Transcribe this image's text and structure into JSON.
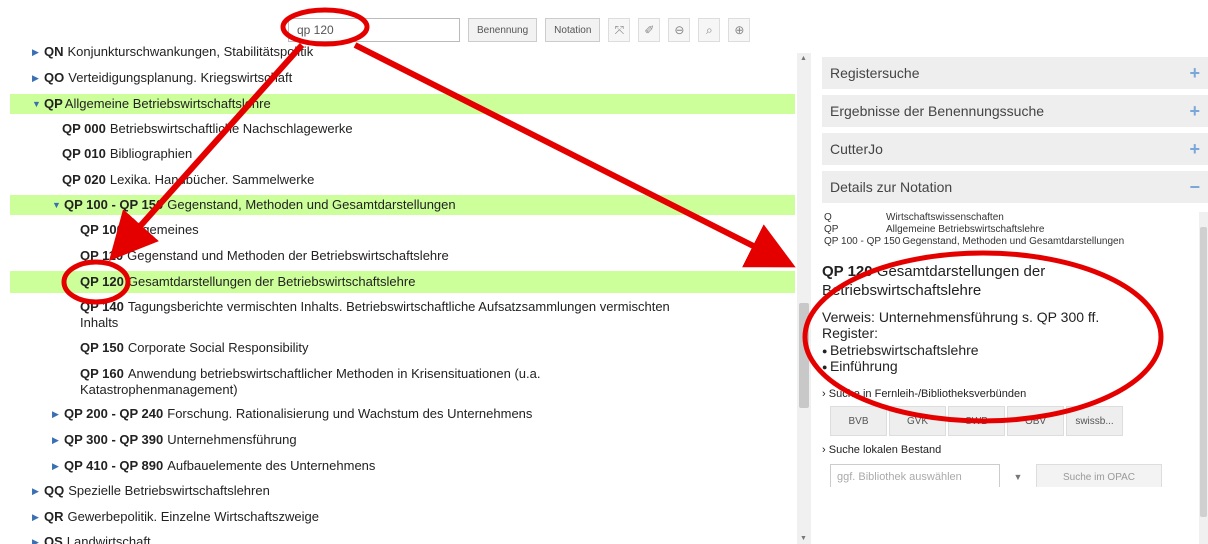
{
  "toolbar": {
    "search_value": "qp 120",
    "benennung": "Benennung",
    "notation": "Notation"
  },
  "tree": {
    "rows": [
      {
        "code": "QN",
        "text": "Konjunkturschwankungen, Stabilitätspolitik"
      },
      {
        "code": "QO",
        "text": "Verteidigungsplanung. Kriegswirtschaft"
      },
      {
        "code": "QP",
        "text": "Allgemeine Betriebswirtschaftslehre"
      },
      {
        "code": "QP 000",
        "text": "Betriebswirtschaftliche Nachschlagewerke"
      },
      {
        "code": "QP 010",
        "text": "Bibliographien"
      },
      {
        "code": "QP 020",
        "text": "Lexika. Handbücher. Sammelwerke"
      },
      {
        "code": "QP 100 - QP 150",
        "text": "Gegenstand, Methoden und Gesamtdarstellungen"
      },
      {
        "code": "QP 100",
        "text": "Allgemeines"
      },
      {
        "code": "QP 110",
        "text": "Gegenstand und Methoden der Betriebswirtschaftslehre"
      },
      {
        "code": "QP 120",
        "text": "Gesamtdarstellungen der Betriebswirtschaftslehre"
      },
      {
        "code": "QP 140",
        "text": "Tagungsberichte vermischten Inhalts. Betriebswirtschaftliche Aufsatzsammlungen vermischten Inhalts"
      },
      {
        "code": "QP 150",
        "text": "Corporate Social Responsibility"
      },
      {
        "code": "QP 160",
        "text": "Anwendung betriebswirtschaftlicher Methoden in Krisensituationen (u.a. Katastrophenmanagement)"
      },
      {
        "code": "QP 200 - QP 240",
        "text": "Forschung. Rationalisierung und Wachstum des Unternehmens"
      },
      {
        "code": "QP 300 - QP 390",
        "text": "Unternehmensführung"
      },
      {
        "code": "QP 410 - QP 890",
        "text": "Aufbauelemente des Unternehmens"
      },
      {
        "code": "QQ",
        "text": "Spezielle Betriebswirtschaftslehren"
      },
      {
        "code": "QR",
        "text": "Gewerbepolitik. Einzelne Wirtschaftszweige"
      },
      {
        "code": "QS",
        "text": "Landwirtschaft"
      }
    ]
  },
  "panel": {
    "registersuche": "Registersuche",
    "ergebnisse": "Ergebnisse der Benennungssuche",
    "cutterjo": "CutterJo",
    "details": "Details zur Notation",
    "plus": "+",
    "minus": "−",
    "hierarchy": [
      {
        "code": "Q",
        "text": "Wirtschaftswissenschaften"
      },
      {
        "code": "QP",
        "text": "Allgemeine Betriebswirtschaftslehre"
      },
      {
        "code": "QP 100 - QP 150",
        "text": "Gegenstand, Methoden und Gesamtdarstellungen"
      }
    ],
    "title_code": "QP 120",
    "title_text": "Gesamtdarstellungen der Betriebswirtschaftslehre",
    "verweis_label": "Verweis:",
    "verweis_text": "Unternehmensführung s. QP 300 ff.",
    "register_label": "Register:",
    "register": [
      "Betriebswirtschaftslehre",
      "Einführung"
    ],
    "suche_fern": "Suche in Fernleih-/Bibliotheksverbünden",
    "libraries": [
      "BVB",
      "GVK",
      "SWB",
      "OBV",
      "swissb..."
    ],
    "suche_lokal": "Suche lokalen Bestand",
    "lib_placeholder": "ggf. Bibliothek auswählen",
    "opac": "Suche im OPAC"
  }
}
